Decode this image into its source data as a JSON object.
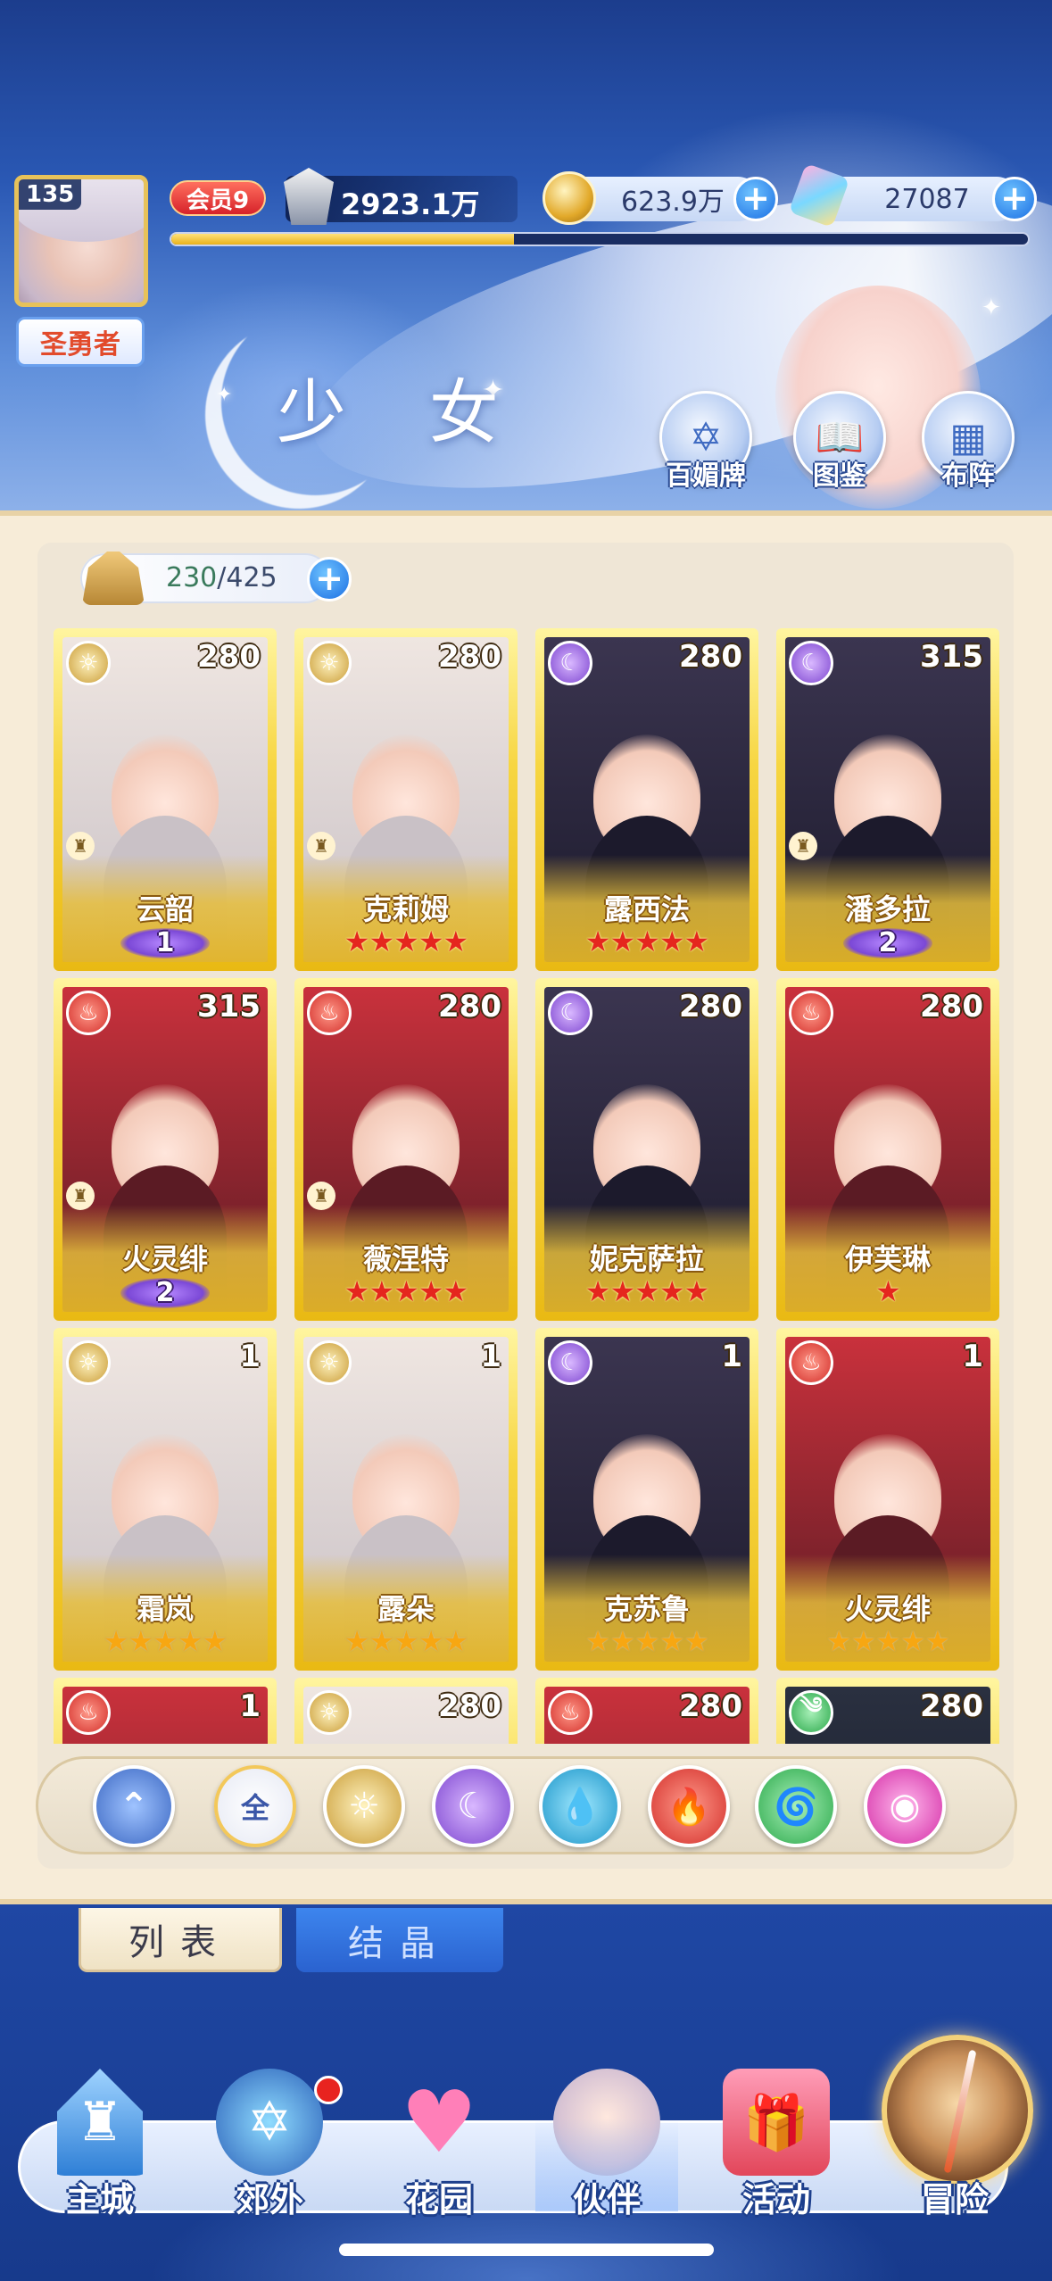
{
  "player": {
    "level": "135",
    "title": "圣勇者",
    "vip": "会员9",
    "power": "2923.1万",
    "exp_progress": 0.4
  },
  "resources": {
    "gold": "623.9万",
    "crystal": "27087"
  },
  "page_title": "少 女",
  "top_buttons": [
    "百媚牌",
    "图鉴",
    "布阵"
  ],
  "bag": {
    "current": "230",
    "total": "/425"
  },
  "cards": [
    {
      "name": "云韶",
      "level": "280",
      "element": "sun",
      "rank_badge": "1",
      "stars": ""
    },
    {
      "name": "克莉姆",
      "level": "280",
      "element": "sun",
      "rank_badge": "",
      "stars": "★★★★★"
    },
    {
      "name": "露西法",
      "level": "280",
      "element": "moon",
      "rank_badge": "",
      "stars": "★★★★★"
    },
    {
      "name": "潘多拉",
      "level": "315",
      "element": "moon",
      "rank_badge": "2",
      "stars": ""
    },
    {
      "name": "火灵绯",
      "level": "315",
      "element": "fire",
      "rank_badge": "2",
      "stars": ""
    },
    {
      "name": "薇涅特",
      "level": "280",
      "element": "fire",
      "rank_badge": "",
      "stars": "★★★★★"
    },
    {
      "name": "妮克萨拉",
      "level": "280",
      "element": "moon",
      "rank_badge": "",
      "stars": "★★★★★"
    },
    {
      "name": "伊芙琳",
      "level": "280",
      "element": "fire",
      "rank_badge": "",
      "stars": "★"
    },
    {
      "name": "霜岚",
      "level": "1",
      "element": "sun",
      "rank_badge": "",
      "stars": "★★★★★"
    },
    {
      "name": "露朵",
      "level": "1",
      "element": "sun",
      "rank_badge": "",
      "stars": "★★★★★"
    },
    {
      "name": "克苏鲁",
      "level": "1",
      "element": "moon",
      "rank_badge": "",
      "stars": "★★★★★"
    },
    {
      "name": "火灵绯",
      "level": "1",
      "element": "fire",
      "rank_badge": "",
      "stars": "★★★★★"
    },
    {
      "name": "",
      "level": "1",
      "element": "fire",
      "rank_badge": "",
      "stars": ""
    },
    {
      "name": "",
      "level": "280",
      "element": "sun",
      "rank_badge": "",
      "stars": ""
    },
    {
      "name": "",
      "level": "280",
      "element": "fire",
      "rank_badge": "",
      "stars": ""
    },
    {
      "name": "",
      "level": "280",
      "element": "wind",
      "rank_badge": "",
      "stars": ""
    }
  ],
  "filters": {
    "all_label": "全",
    "items": [
      "sort-icon",
      "all",
      "sun-icon",
      "moon-icon",
      "water-icon",
      "fire-icon",
      "wind-icon",
      "charm-icon"
    ]
  },
  "tabs": {
    "list": "列表",
    "crystal": "结晶"
  },
  "nav": [
    {
      "label": "主城",
      "icon": "castle-icon"
    },
    {
      "label": "郊外",
      "icon": "portal-icon"
    },
    {
      "label": "花园",
      "icon": "heart-icon"
    },
    {
      "label": "伙伴",
      "icon": "partner-icon"
    },
    {
      "label": "活动",
      "icon": "gift-icon"
    },
    {
      "label": "冒险",
      "icon": "compass-icon"
    }
  ],
  "colors": {
    "card_gold": "#f7d642",
    "star_red": "#e5261e",
    "star_gold": "#f7a712",
    "accent_blue": "#1b6fe3"
  }
}
